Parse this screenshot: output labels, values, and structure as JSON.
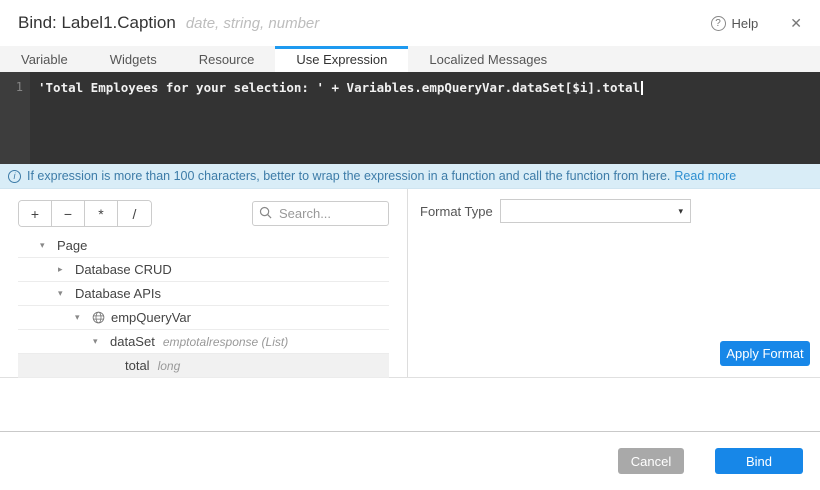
{
  "header": {
    "title": "Bind: Label1.Caption",
    "subtitle": "date, string, number",
    "help_label": "Help"
  },
  "tabs": [
    {
      "label": "Variable",
      "active": false
    },
    {
      "label": "Widgets",
      "active": false
    },
    {
      "label": "Resource",
      "active": false
    },
    {
      "label": "Use Expression",
      "active": true
    },
    {
      "label": "Localized Messages",
      "active": false
    }
  ],
  "editor": {
    "line_number": "1",
    "code": "'Total Employees for your selection: ' + Variables.empQueryVar.dataSet[$i].total"
  },
  "info_bar": {
    "message": "If expression is more than 100 characters, better to wrap the expression in a function and call the function from here.",
    "link_label": "Read more"
  },
  "toolbar": {
    "operators": [
      "+",
      "−",
      "*",
      "/"
    ],
    "search_placeholder": "Search..."
  },
  "tree": {
    "items": [
      {
        "label": "Page",
        "type": "",
        "state": "expanded",
        "arrow": "▾",
        "selected": false
      },
      {
        "label": "Database CRUD",
        "type": "",
        "state": "collapsed",
        "arrow": "▸",
        "selected": false
      },
      {
        "label": "Database APIs",
        "type": "",
        "state": "expanded",
        "arrow": "▾",
        "selected": false
      },
      {
        "label": "empQueryVar",
        "type": "",
        "state": "expanded",
        "arrow": "▾",
        "selected": false,
        "icon": "service-variable-icon"
      },
      {
        "label": "dataSet",
        "type": "emptotalresponse (List)",
        "state": "expanded",
        "arrow": "▾",
        "selected": false
      },
      {
        "label": "total",
        "type": "long",
        "state": "leaf",
        "arrow": "",
        "selected": true
      }
    ]
  },
  "format_panel": {
    "label": "Format Type",
    "selected_value": "",
    "apply_label": "Apply Format"
  },
  "footer": {
    "cancel_label": "Cancel",
    "bind_label": "Bind"
  },
  "icons": {
    "help": "?",
    "close": "✕",
    "info": "i",
    "select_arrow": "▾"
  },
  "colors": {
    "accent_blue": "#1787e8",
    "tab_active_indicator": "#1e9af0",
    "info_bar_bg": "#d9edf7",
    "editor_bg": "#333333",
    "editor_gutter_bg": "#3d3d3d",
    "selected_row_bg": "#f1f1f1",
    "cancel_gray": "#a9a9a9"
  }
}
